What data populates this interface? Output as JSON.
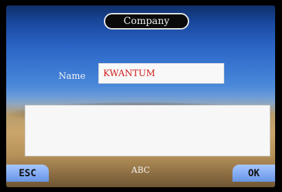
{
  "header": {
    "title": "Company"
  },
  "form": {
    "name_label": "Name",
    "name_value": "KWANTUM"
  },
  "input_mode": "ABC",
  "buttons": {
    "esc": "ESC",
    "ok": "OK"
  }
}
